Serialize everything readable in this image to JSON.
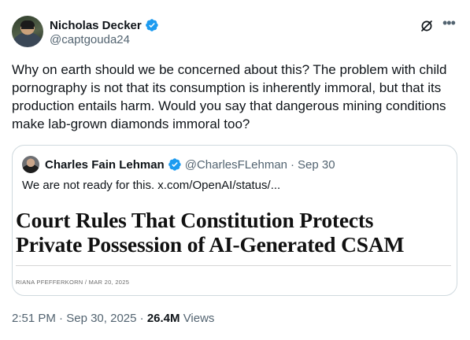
{
  "author": {
    "display_name": "Nicholas Decker",
    "handle": "@captgouda24",
    "verified": true
  },
  "tweet_text": "Why on earth should we be concerned about this? The problem with child pornography is not that its consumption is inherently immoral, but that its production entails harm. Would you say that dangerous mining conditions make lab-grown diamonds immoral too?",
  "quoted": {
    "display_name": "Charles Fain Lehman",
    "handle": "@CharlesFLehman",
    "separator": "·",
    "date": "Sep 30",
    "text": "We are not ready for this.  x.com/OpenAI/status/...",
    "article_title": "Court Rules That Constitution Protects Private Possession of AI-Generated CSAM",
    "article_byline": "RIANA PFEFFERKORN / MAR 20, 2025"
  },
  "meta": {
    "time": "2:51 PM",
    "separator": "·",
    "date": "Sep 30, 2025",
    "views_count": "26.4M",
    "views_label": "Views"
  },
  "icons": {
    "verified": "verified-badge-icon",
    "grok": "grok-icon",
    "more": "more-icon"
  },
  "colors": {
    "verified_blue": "#1d9bf0",
    "text_primary": "#0f1419",
    "text_secondary": "#536471",
    "border": "#cfd9de"
  }
}
